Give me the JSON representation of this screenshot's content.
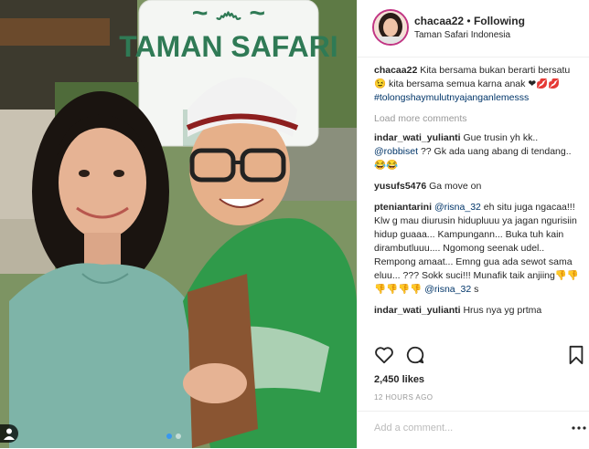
{
  "post": {
    "image_alt": "Photo of two people smiling in front of a Taman Safari sign",
    "sign_text": "TAMAN SAFARI",
    "carousel_count": 2,
    "carousel_active": 1
  },
  "header": {
    "username": "chacaa22",
    "separator": "•",
    "follow_status": "Following",
    "location": "Taman Safari Indonesia"
  },
  "caption": {
    "username": "chacaa22",
    "text": "Kita bersama bukan berarti bersatu 😉 kita bersama semua karna anak ❤💋💋",
    "hashtag": "#tolongshaymulutnyajanganlemesss"
  },
  "load_more": "Load more comments",
  "comments": [
    {
      "user": "indar_wati_yulianti",
      "text": "Gue trusin yh kk..",
      "mention": "@robbiset",
      "text2": "?? Gk ada uang abang di tendang.. 😂😂"
    },
    {
      "user": "yusufs5476",
      "text": "Ga move on"
    },
    {
      "user": "pteniantarini",
      "mention": "@risna_32",
      "text": "eh situ juga ngacaa!!! Klw g mau diurusin hidupluuu ya jagan ngurisiin hidup guaaa... Kampungann... Buka tuh kain dirambutluuu.... Ngomong seenak udel.. Rempong amaat... Emng gua ada sewot sama eluu... ??? Sokk suci!!! Munafik taik anjiing👎👎👎👎👎👎",
      "mention2": "@risna_32",
      "text2": "s"
    },
    {
      "user": "indar_wati_yulianti",
      "text": "Hrus nya yg prtma"
    }
  ],
  "icons": {
    "like": "heart-icon",
    "comment": "comment-icon",
    "save": "bookmark-icon",
    "more": "more-options-icon"
  },
  "likes": "2,450 likes",
  "timestamp": "12 HOURS AGO",
  "add_comment": {
    "placeholder": "Add a comment..."
  },
  "colors": {
    "link": "#003569",
    "muted": "#999999",
    "accent": "#3897f0",
    "border": "#efefef"
  }
}
